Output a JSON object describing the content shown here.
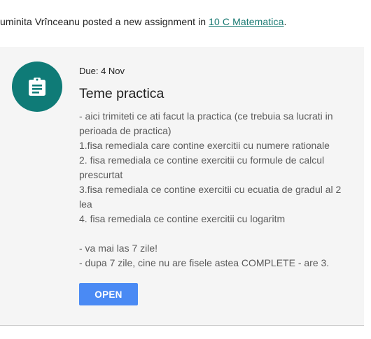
{
  "notice": {
    "author": "uminita Vrînceanu",
    "text": " posted a new assignment in ",
    "class_link": "10 C Matematica",
    "suffix": "."
  },
  "assignment": {
    "icon": "assignment-clipboard-icon",
    "accent_color": "#0f7b77",
    "due": "Due: 4 Nov",
    "title": "Teme practica",
    "description_lines": [
      "- aici trimiteti ce ati facut la practica (ce trebuia sa lucrati in",
      "perioada de practica)",
      "1.fisa remediala care contine exercitii cu numere rationale",
      "2. fisa remediala ce contine exercitii cu formule de calcul",
      "prescurtat",
      "3.fisa remediala ce contine exercitii cu ecuatia de gradul al 2",
      "lea",
      "4. fisa remediala ce contine exercitii cu logaritm",
      "",
      "- va mai las 7 zile!",
      "- dupa 7 zile, cine nu are fisele astea COMPLETE - are 3."
    ],
    "open_label": "OPEN",
    "button_color": "#4a8af4"
  }
}
